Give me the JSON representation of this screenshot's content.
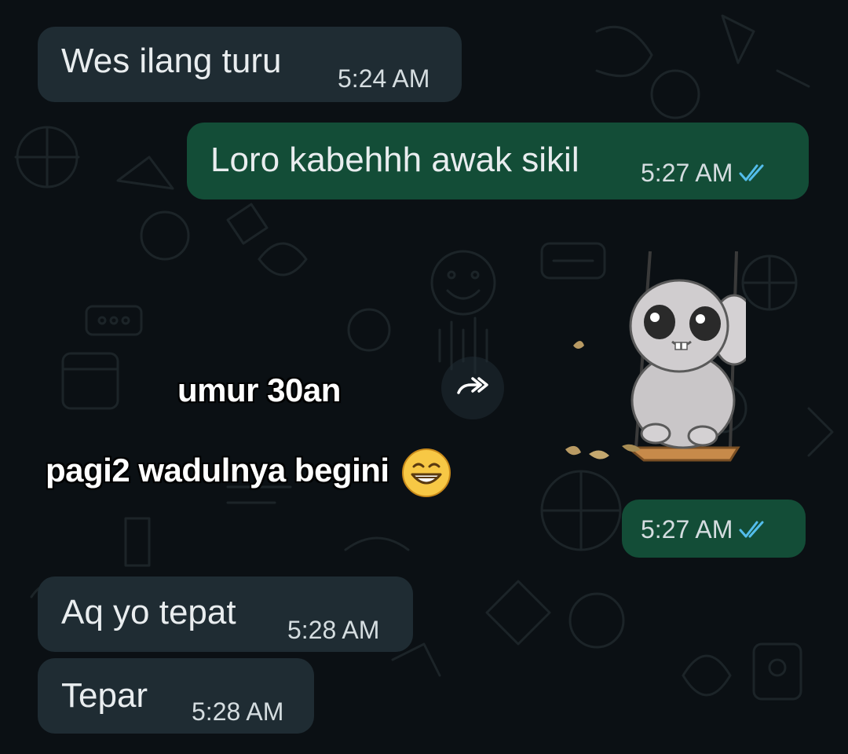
{
  "messages": [
    {
      "text": "Wes ilang turu",
      "time": "5:24 AM",
      "direction": "incoming"
    },
    {
      "text": "Loro kabehhh awak sikil",
      "time": "5:27 AM",
      "direction": "outgoing",
      "status": "read"
    },
    {
      "time": "5:27 AM",
      "direction": "outgoing",
      "status": "read",
      "type": "sticker"
    },
    {
      "text": "Aq yo tepat",
      "time": "5:28 AM",
      "direction": "incoming"
    },
    {
      "text": "Tepar",
      "time": "5:28 AM",
      "direction": "incoming"
    }
  ],
  "sticker": {
    "caption_line1": "umur 30an",
    "caption_line2": "pagi2 wadulnya begini",
    "icons": [
      "grinning-emoji-icon",
      "rabbit-on-swing-icon"
    ]
  },
  "icons": {
    "forward": "forward-icon",
    "read_receipt": "double-check-icon"
  },
  "colors": {
    "background": "#0b1014",
    "incoming_bubble": "#1f2c33",
    "outgoing_bubble": "#134d37",
    "read_tick": "#53bdeb",
    "text": "#e9edef"
  }
}
